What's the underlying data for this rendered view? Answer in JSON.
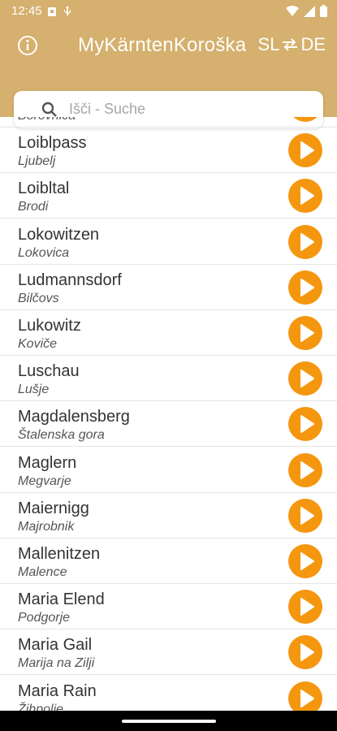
{
  "status_bar": {
    "time": "12:45",
    "icons": [
      "sim-card-icon",
      "usb-icon",
      "wifi-icon",
      "signal-icon",
      "battery-icon"
    ]
  },
  "app_bar": {
    "title": "MyKärntenKoroška",
    "lang_from": "SL",
    "lang_to": "DE",
    "info_icon": "info-icon",
    "swap_icon": "swap-arrows-icon"
  },
  "search": {
    "placeholder": "Išči - Suche",
    "icon": "search-icon"
  },
  "places": [
    {
      "de": "",
      "sl": "Borovnica"
    },
    {
      "de": "Loiblpass",
      "sl": "Ljubelj"
    },
    {
      "de": "Loibltal",
      "sl": "Brodi"
    },
    {
      "de": "Lokowitzen",
      "sl": "Lokovica"
    },
    {
      "de": "Ludmannsdorf",
      "sl": "Bilčovs"
    },
    {
      "de": "Lukowitz",
      "sl": "Koviče"
    },
    {
      "de": "Luschau",
      "sl": "Lušje"
    },
    {
      "de": "Magdalensberg",
      "sl": "Štalenska gora"
    },
    {
      "de": "Maglern",
      "sl": "Megvarje"
    },
    {
      "de": "Maiernigg",
      "sl": "Majrobnik"
    },
    {
      "de": "Mallenitzen",
      "sl": "Malence"
    },
    {
      "de": "Maria Elend",
      "sl": "Podgorje"
    },
    {
      "de": "Maria Gail",
      "sl": "Marija na Zilji"
    },
    {
      "de": "Maria Rain",
      "sl": "Žihpolje"
    }
  ],
  "colors": {
    "header": "#d5b06e",
    "play_button": "#f4970f",
    "divider": "#e4e4e4"
  }
}
